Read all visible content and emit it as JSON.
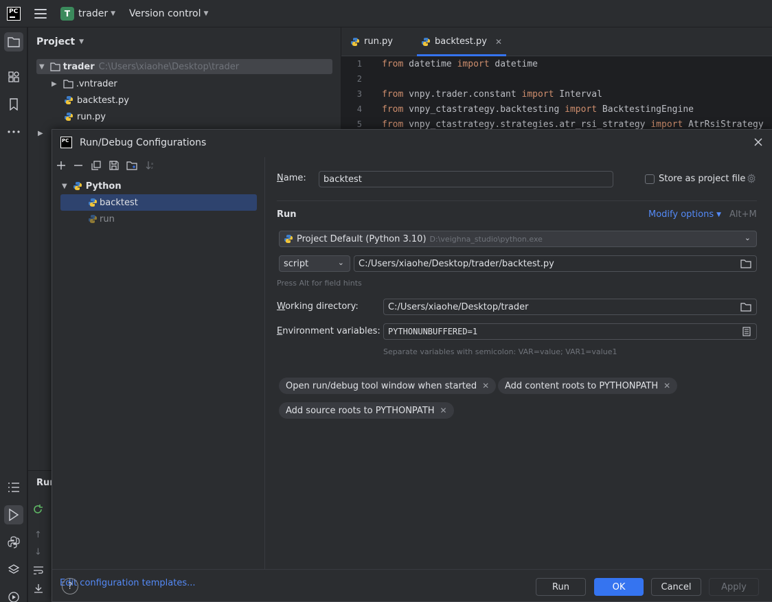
{
  "topbar": {
    "logo_text": "PC",
    "project_badge": "T",
    "project_name": "trader",
    "vcs_label": "Version control"
  },
  "project_panel": {
    "title": "Project",
    "root_name": "trader",
    "root_path": "C:\\Users\\xiaohe\\Desktop\\trader",
    "items": [
      {
        "label": ".vntrader",
        "icon": "folder-icon"
      },
      {
        "label": "backtest.py",
        "icon": "python-file-icon"
      },
      {
        "label": "run.py",
        "icon": "python-file-icon"
      }
    ]
  },
  "editor": {
    "tabs": [
      {
        "label": "run.py",
        "active": false
      },
      {
        "label": "backtest.py",
        "active": true
      }
    ],
    "lines": [
      {
        "num": "1",
        "parts": [
          [
            "kw",
            "from"
          ],
          [
            "t",
            " datetime "
          ],
          [
            "kw",
            "import"
          ],
          [
            "t",
            " datetime"
          ]
        ]
      },
      {
        "num": "2",
        "parts": []
      },
      {
        "num": "3",
        "parts": [
          [
            "kw",
            "from"
          ],
          [
            "t",
            " vnpy.trader.constant "
          ],
          [
            "kw",
            "import"
          ],
          [
            "t",
            " Interval"
          ]
        ]
      },
      {
        "num": "4",
        "parts": [
          [
            "kw",
            "from"
          ],
          [
            "t",
            " vnpy_ctastrategy.backtesting "
          ],
          [
            "kw",
            "import"
          ],
          [
            "t",
            " BacktestingEngine"
          ]
        ]
      },
      {
        "num": "5",
        "parts": [
          [
            "kw",
            "from"
          ],
          [
            "t",
            " vnpy_ctastrategy.strategies.atr_rsi_strategy "
          ],
          [
            "kw",
            "import"
          ],
          [
            "t",
            " AtrRsiStrategy"
          ]
        ]
      }
    ]
  },
  "run_panel": {
    "title": "Run"
  },
  "dialog": {
    "title": "Run/Debug Configurations",
    "tree": {
      "group": "Python",
      "items": [
        {
          "label": "backtest",
          "selected": true
        },
        {
          "label": "run",
          "selected": false
        }
      ]
    },
    "edit_templates": "Edit configuration templates...",
    "name_label_pre": "N",
    "name_label_post": "ame:",
    "name_value": "backtest",
    "store_label": "Store as project file",
    "run_section": "Run",
    "modify_options": "Modify options",
    "modify_shortcut": "Alt+M",
    "interpreter_name": "Project Default (Python 3.10)",
    "interpreter_path": "D:\\veighna_studio\\python.exe",
    "script_type": "script",
    "script_path": "C:/Users/xiaohe/Desktop/trader/backtest.py",
    "field_hint": "Press Alt for field hints",
    "workdir_label_pre": "W",
    "workdir_label_post": "orking directory:",
    "workdir_value": "C:/Users/xiaohe/Desktop/trader",
    "env_label_pre": "E",
    "env_label_post": "nvironment variables:",
    "env_value": "PYTHONUNBUFFERED=1",
    "env_hint": "Separate variables with semicolon: VAR=value; VAR1=value1",
    "chips": [
      "Open run/debug tool window when started",
      "Add content roots to PYTHONPATH",
      "Add source roots to PYTHONPATH"
    ],
    "buttons": {
      "help": "?",
      "run": "Run",
      "ok": "OK",
      "cancel": "Cancel",
      "apply": "Apply"
    }
  },
  "colors": {
    "accent": "#3574f0",
    "keyword": "#cf8e6d",
    "link": "#548af7",
    "selection": "#2e436e"
  }
}
